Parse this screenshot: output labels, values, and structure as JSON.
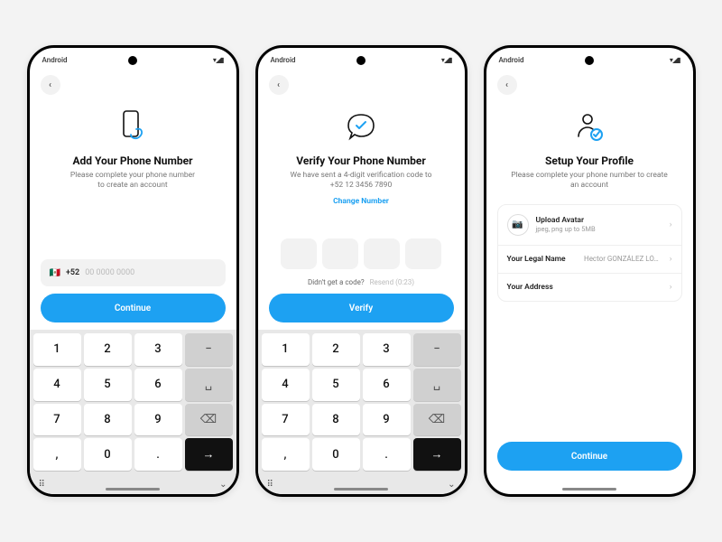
{
  "platform_label": "Android",
  "screens": [
    {
      "title": "Add Your Phone Number",
      "subtitle_line1": "Please complete your phone number",
      "subtitle_line2": "to create an account",
      "phone_prefix": "+52",
      "phone_placeholder": "00 0000 0000",
      "primary_button": "Continue"
    },
    {
      "title": "Verify Your Phone Number",
      "subtitle_line1": "We have sent a 4-digit verification code to",
      "subtitle_line2": "+52 12 3456 7890",
      "change_number": "Change Number",
      "resend_prompt": "Didn't get a code?",
      "resend_label": "Resend (0:23)",
      "primary_button": "Verify"
    },
    {
      "title": "Setup Your Profile",
      "subtitle_line1": "Please complete your phone number to create",
      "subtitle_line2": "an account",
      "upload_title": "Upload Avatar",
      "upload_sub": "jpeg, png up to 5MB",
      "name_label": "Your Legal Name",
      "name_value": "Hector GONZÁLEZ LÓ…",
      "address_label": "Your Address",
      "primary_button": "Continue"
    }
  ],
  "keypad": {
    "keys": [
      "1",
      "2",
      "3",
      "4",
      "5",
      "6",
      "7",
      "8",
      "9",
      ",",
      "0",
      "."
    ],
    "minus": "−",
    "space": "␣",
    "backspace": "⌫",
    "enter": "→"
  }
}
